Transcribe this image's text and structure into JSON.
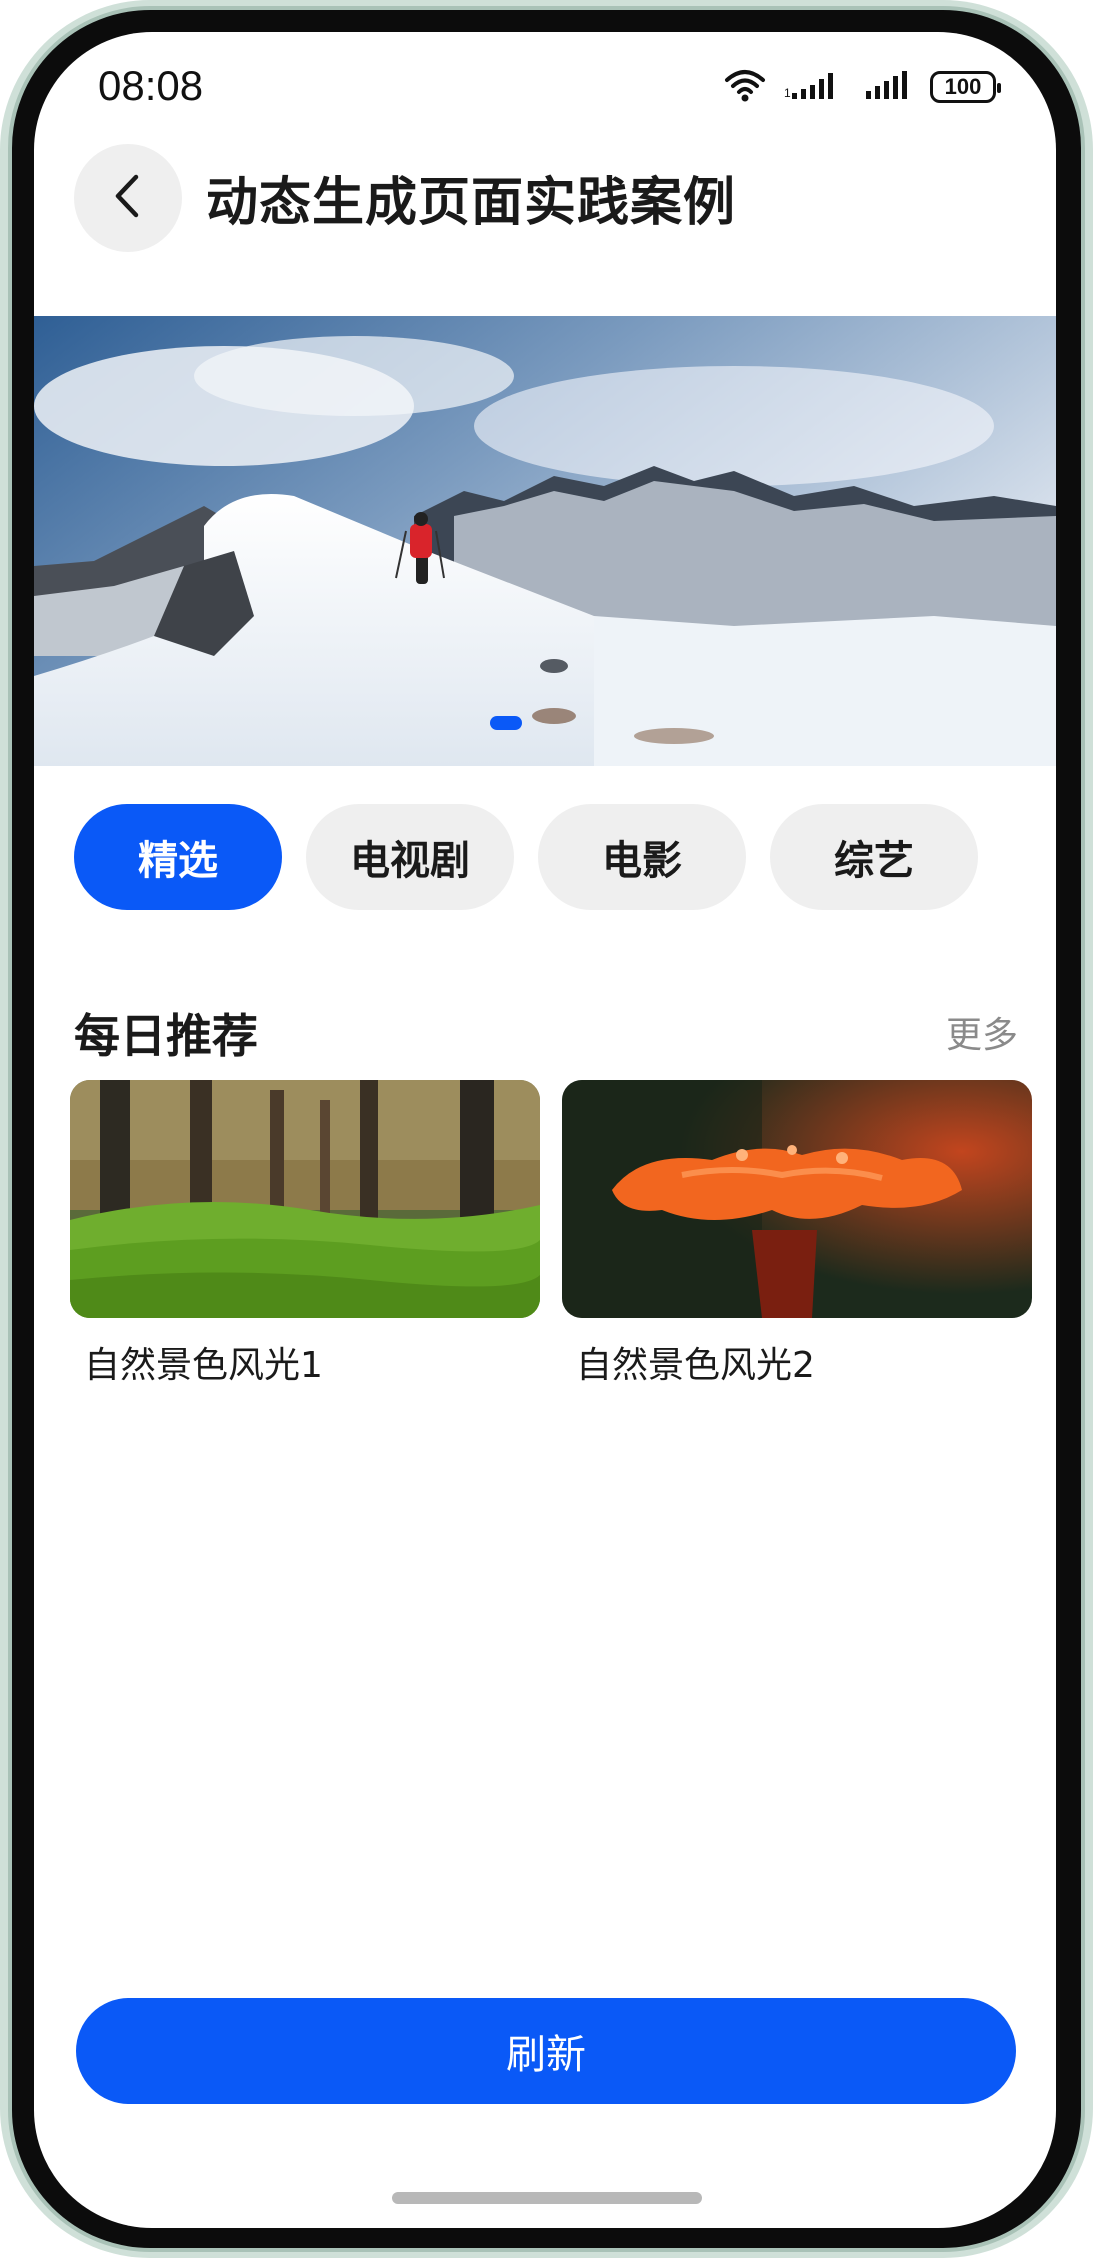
{
  "status_bar": {
    "time": "08:08",
    "battery": "100",
    "icons": [
      "wifi-icon",
      "signal-icon",
      "signal-icon",
      "battery-icon"
    ]
  },
  "header": {
    "back_icon": "chevron-left-icon",
    "title": "动态生成页面实践案例"
  },
  "banner": {
    "image": "snowy-mountain-hiker",
    "active_page": 1
  },
  "tabs": [
    {
      "label": "精选",
      "active": true
    },
    {
      "label": "电视剧",
      "active": false
    },
    {
      "label": "电影",
      "active": false
    },
    {
      "label": "综艺",
      "active": false
    }
  ],
  "section": {
    "title": "每日推荐",
    "more": "更多"
  },
  "cards": [
    {
      "label": "自然景色风光1",
      "image": "forest-grass"
    },
    {
      "label": "自然景色风光2",
      "image": "orange-flower"
    }
  ],
  "refresh_label": "刷新",
  "colors": {
    "accent": "#0a59f7",
    "tab_bg": "#efefef",
    "muted_text": "#8a8a8a"
  }
}
